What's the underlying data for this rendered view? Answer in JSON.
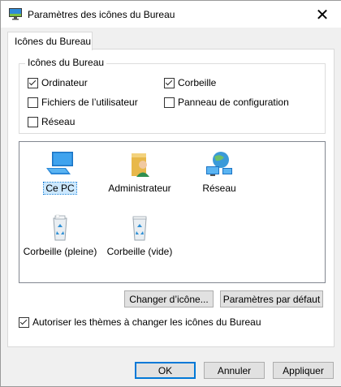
{
  "window": {
    "title": "Paramètres des icônes du Bureau",
    "close_glyph": "✕"
  },
  "tabs": [
    {
      "label": "Icônes du Bureau"
    }
  ],
  "group": {
    "label": "Icônes du Bureau",
    "checkboxes": [
      {
        "label": "Ordinateur",
        "checked": true
      },
      {
        "label": "Corbeille",
        "checked": true
      },
      {
        "label": "Fichiers de l’utilisateur",
        "checked": false
      },
      {
        "label": "Panneau de configuration",
        "checked": false
      },
      {
        "label": "Réseau",
        "checked": false
      }
    ]
  },
  "icons": [
    {
      "label": "Ce PC",
      "icon": "computer-icon",
      "selected": true
    },
    {
      "label": "Administrateur",
      "icon": "user-folder-icon",
      "selected": false
    },
    {
      "label": "Réseau",
      "icon": "network-icon",
      "selected": false
    },
    {
      "label": "Corbeille (pleine)",
      "icon": "recycle-bin-full-icon",
      "selected": false
    },
    {
      "label": "Corbeille (vide)",
      "icon": "recycle-bin-empty-icon",
      "selected": false
    }
  ],
  "buttons": {
    "change_icon": "Changer d’icône...",
    "default_settings": "Paramètres par défaut",
    "ok": "OK",
    "cancel": "Annuler",
    "apply": "Appliquer"
  },
  "themes_checkbox": {
    "label": "Autoriser les thèmes à changer les icônes du Bureau",
    "checked": true
  },
  "colors": {
    "accent": "#0078d7",
    "selection": "#cce8ff"
  }
}
